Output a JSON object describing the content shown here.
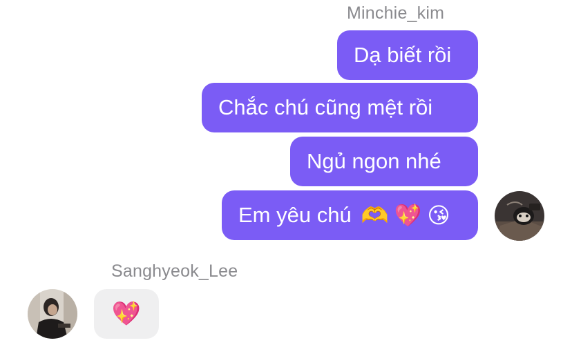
{
  "outgoing": {
    "sender": "Minchie_kim",
    "messages": [
      {
        "text": "Dạ biết rồi"
      },
      {
        "text": "Chắc chú cũng mệt rồi"
      },
      {
        "text": "Ngủ ngon nhé"
      },
      {
        "text": "Em yêu chú",
        "emojis": [
          "🫶",
          "💖",
          "😘"
        ]
      }
    ]
  },
  "incoming": {
    "sender": "Sanghyeok_Lee",
    "messages": [
      {
        "emoji": "💖"
      }
    ]
  },
  "colors": {
    "outgoing_bubble": "#7b5cf5",
    "incoming_bubble": "#efeff0",
    "sender_name": "#8a8a8e"
  }
}
